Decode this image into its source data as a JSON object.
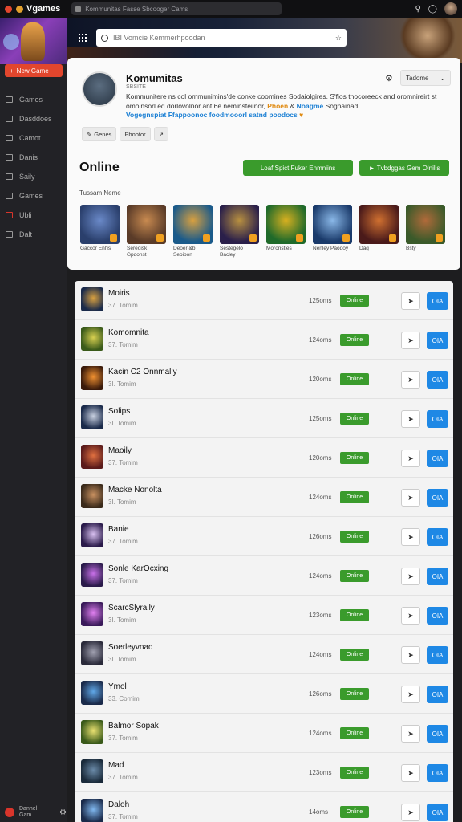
{
  "app": {
    "brand": "Vgames",
    "url": "Kommunitas Fasse Sbcooger Cams"
  },
  "topbar_icons": [
    "search-icon",
    "bell-icon",
    "avatar"
  ],
  "sidebar": {
    "new_game_label": "New Game",
    "items": [
      {
        "label": "Games",
        "icon": "gamepad-icon"
      },
      {
        "label": "Dasddoes",
        "icon": "home-icon"
      },
      {
        "label": "Camot",
        "icon": "box-icon"
      },
      {
        "label": "Danis",
        "icon": "chat-icon"
      },
      {
        "label": "Saily",
        "icon": "star-icon"
      },
      {
        "label": "Games",
        "icon": "grid-icon"
      },
      {
        "label": "Ubli",
        "icon": "friends-icon"
      },
      {
        "label": "Dalt",
        "icon": "settings-icon"
      }
    ],
    "footer": {
      "name": "Dannel Gam"
    }
  },
  "search": {
    "placeholder": "IBI Vomcie Kemmerhpoodan"
  },
  "community": {
    "name": "Komumitas",
    "subtitle": "SBSITE",
    "desc_part1": "Kommunitere ns col ommunimins'de conke coomines Sodaiolgires. S'fios tnocoreeck and oromnireirt st omoinsorl ed dorlovolnor ant 6e neminsteiinor, ",
    "desc_hl1": "Phoen",
    "desc_amp": " & ",
    "desc_hl2": "Noagme",
    "desc_part2": " Sognainad",
    "hashtags": "Vogegnspiat Ffappoonoc foodmooorl satnd poodocs",
    "buttons": [
      {
        "label": "Genes",
        "icon": "chat-icon"
      },
      {
        "label": "Pbootor",
        "icon": ""
      },
      {
        "label": "",
        "icon": "share-icon"
      }
    ],
    "settings_icon": "gear-icon",
    "dropdown_label": "Tadome"
  },
  "online": {
    "heading": "Online",
    "btn1": "Loaf Spict Fuker Enmniins",
    "btn2": "Tvbdggas Gem Olnilis",
    "featured_label": "Tussam Neme",
    "thumbs": [
      {
        "name": "Gaccor Enl'is",
        "color1": "#2a3f6c",
        "color2": "#6a89c8"
      },
      {
        "name": "Sereoisk Gpdonst",
        "color1": "#5a3b28",
        "color2": "#c88a50"
      },
      {
        "name": "Deoer &b Seoibon",
        "color1": "#1a5a8a",
        "color2": "#d8a040"
      },
      {
        "name": "Sestegelo Bacley",
        "color1": "#2a1f4a",
        "color2": "#b89040"
      },
      {
        "name": "Moronsties",
        "color1": "#1f6a2a",
        "color2": "#d8b020"
      },
      {
        "name": "Nenley Paodoy",
        "color1": "#1a3a6a",
        "color2": "#8ab8e8"
      },
      {
        "name": "Daq",
        "color1": "#4a1a1a",
        "color2": "#d07030"
      },
      {
        "name": "Bsty",
        "color1": "#3a5a2a",
        "color2": "#b06a3a"
      }
    ]
  },
  "servers": [
    {
      "name": "Moiris",
      "sub": "37. Tomim",
      "ping": "125oms",
      "status": "Online",
      "go": "OIA",
      "c1": "#1a2a4a",
      "c2": "#d8a040"
    },
    {
      "name": "Komomnita",
      "sub": "37. Tomim",
      "ping": "124oms",
      "status": "Online",
      "go": "OIA",
      "c1": "#3a5a1a",
      "c2": "#d8d050"
    },
    {
      "name": "Kacin C2 Onnmally",
      "sub": "3I. Tomim",
      "ping": "120oms",
      "status": "Online",
      "go": "OIA",
      "c1": "#3a1a0a",
      "c2": "#f09030"
    },
    {
      "name": "Solips",
      "sub": "3I. Tomim",
      "ping": "125oms",
      "status": "Online",
      "go": "OIA",
      "c1": "#1a2a4a",
      "c2": "#c8d0e0"
    },
    {
      "name": "Maoily",
      "sub": "37. Tomim",
      "ping": "120oms",
      "status": "Online",
      "go": "OIA",
      "c1": "#5a1a1a",
      "c2": "#e07040"
    },
    {
      "name": "Macke Nonolta",
      "sub": "3I. Tomim",
      "ping": "124oms",
      "status": "Online",
      "go": "OIA",
      "c1": "#3a2a1a",
      "c2": "#c89060"
    },
    {
      "name": "Banie",
      "sub": "37. Tomim",
      "ping": "126oms",
      "status": "Online",
      "go": "OIA",
      "c1": "#2a1a4a",
      "c2": "#d8c0f0"
    },
    {
      "name": "Sonle KarOcxing",
      "sub": "37. Tomim",
      "ping": "124oms",
      "status": "Online",
      "go": "OIA",
      "c1": "#2a1a4a",
      "c2": "#c870e8"
    },
    {
      "name": "ScarcSlyrally",
      "sub": "3I. Tomim",
      "ping": "123oms",
      "status": "Online",
      "go": "OIA",
      "c1": "#3a1a5a",
      "c2": "#e080f0"
    },
    {
      "name": "Soerleyvnad",
      "sub": "3I. Tomim",
      "ping": "124oms",
      "status": "Online",
      "go": "OIA",
      "c1": "#2a2a3a",
      "c2": "#a0a0b0"
    },
    {
      "name": "Ymol",
      "sub": "33. Comim",
      "ping": "126oms",
      "status": "Online",
      "go": "OIA",
      "c1": "#1a2a4a",
      "c2": "#60a8e8"
    },
    {
      "name": "Balmor Sopak",
      "sub": "37. Tomim",
      "ping": "124oms",
      "status": "Online",
      "go": "OIA",
      "c1": "#3a5a1a",
      "c2": "#e8e070"
    },
    {
      "name": "Mad",
      "sub": "37. Tomim",
      "ping": "123oms",
      "status": "Online",
      "go": "OIA",
      "c1": "#1a2a3a",
      "c2": "#6a8aa8"
    },
    {
      "name": "Daloh",
      "sub": "37. Tomim",
      "ping": "14oms",
      "status": "Online",
      "go": "OIA",
      "c1": "#1a2a4a",
      "c2": "#80b8f0"
    }
  ],
  "colors": {
    "accent_green": "#3a9b2c",
    "accent_blue": "#1e88e5",
    "accent_red": "#e2462d"
  }
}
